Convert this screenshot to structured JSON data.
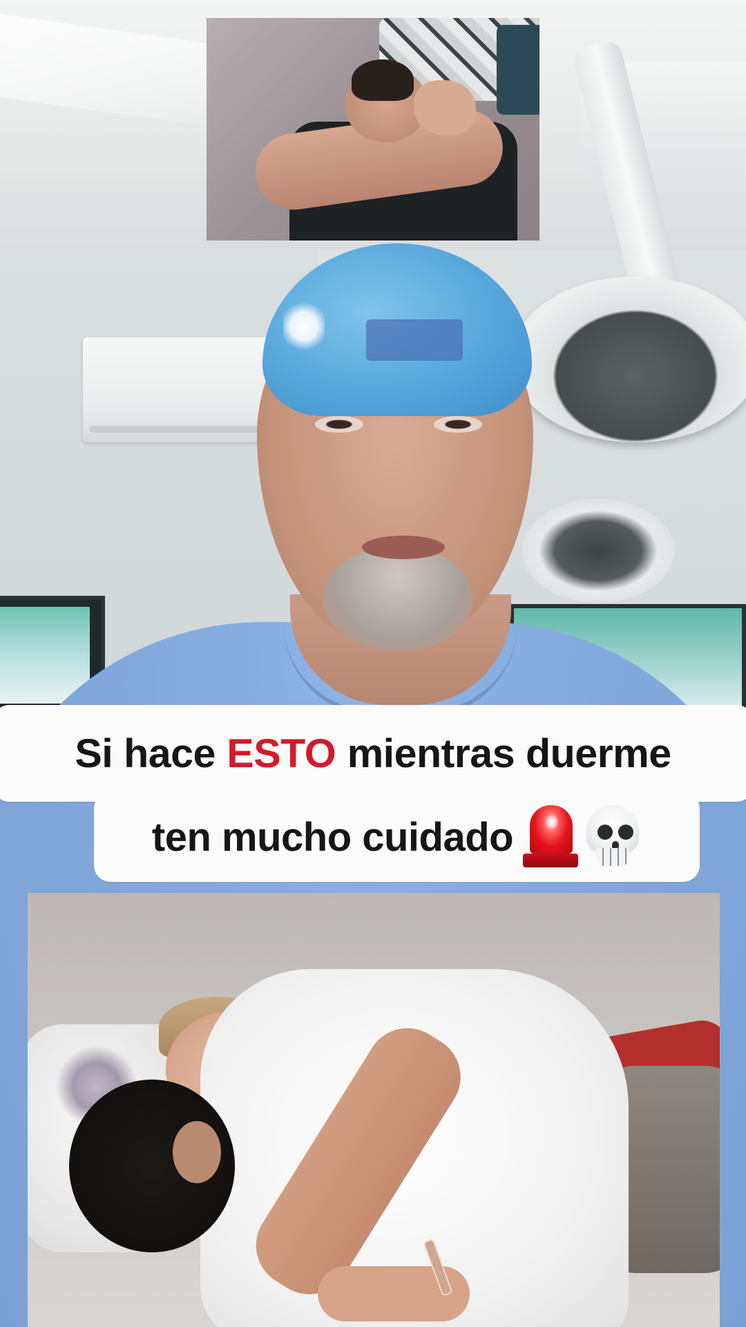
{
  "caption": {
    "line1": {
      "before": "Si hace",
      "highlight": "ESTO",
      "after": "mientras duerme"
    },
    "line2": {
      "text": "ten mucho cuidado",
      "emojis": [
        "siren-icon",
        "skull-icon"
      ]
    },
    "highlight_color": "#d11b2b"
  },
  "scene": {
    "background": "doctor-in-operating-room",
    "top_photo": "man-sleeping-on-bed",
    "bottom_photo": "couple-sleeping-embracing"
  }
}
